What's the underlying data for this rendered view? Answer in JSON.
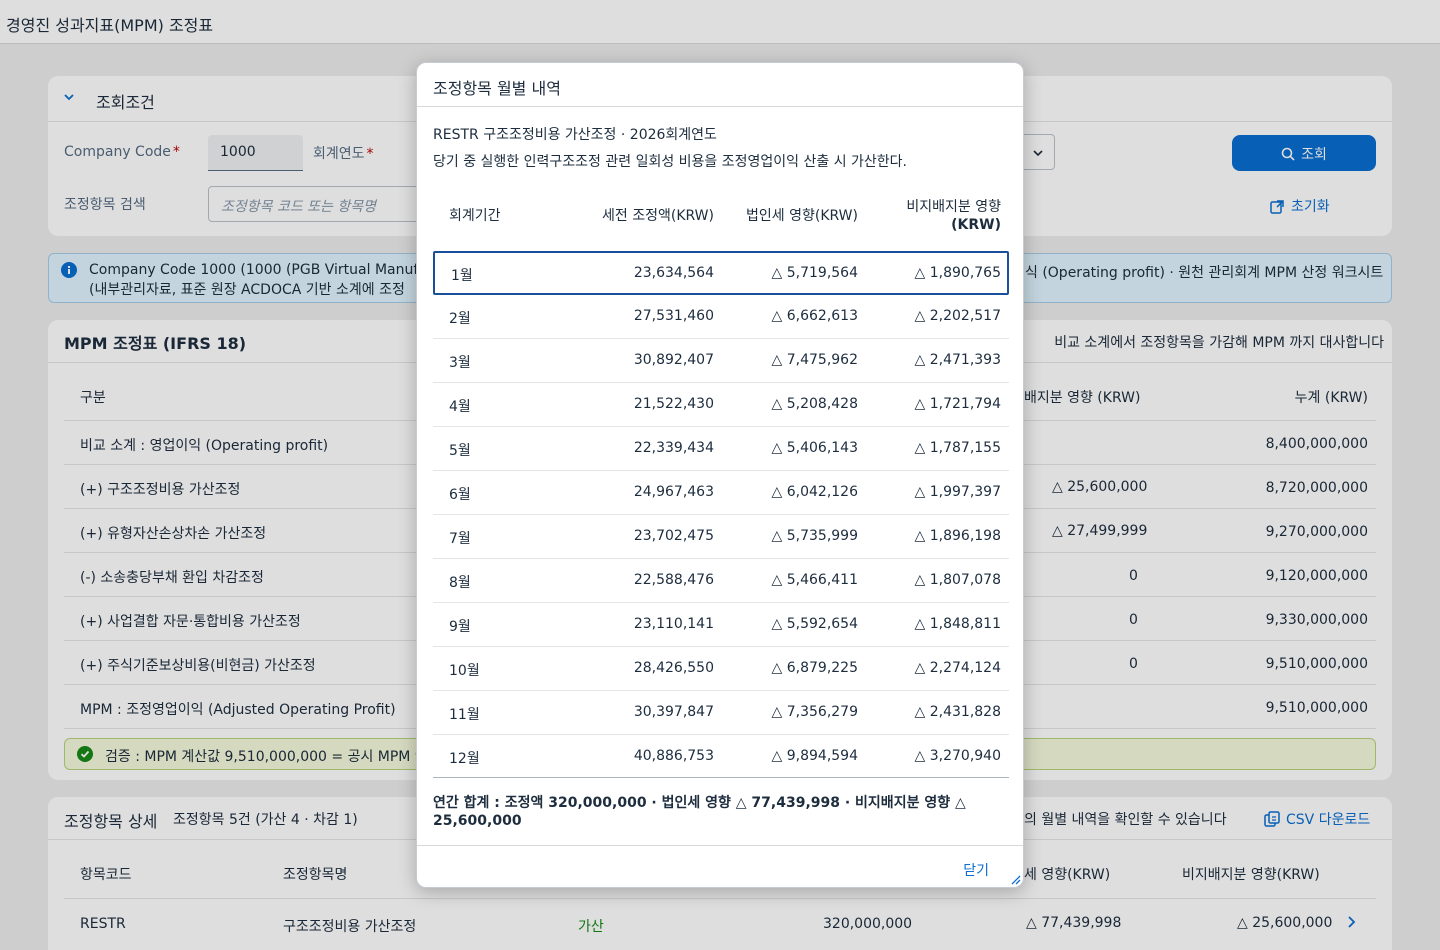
{
  "app": {
    "title": "경영진 성과지표(MPM) 조정표"
  },
  "filter": {
    "header": "조회조건",
    "company_code_label": "Company Code",
    "company_code_value": "1000",
    "fiscal_year_label": "회계연도",
    "required_mark": "*",
    "search_label": "조정항목 검색",
    "search_placeholder": "조정항목 코드 또는 항목명",
    "search_button": "조회",
    "reset_button": "초기화"
  },
  "info": {
    "line1": "Company Code 1000 (1000 (PGB Virtual Manufacturi",
    "line2": "(내부관리자료, 표준 원장 ACDOCA 기반 소계에 조정",
    "line1_tail": "식 (Operating profit) · 원천 관리회계 MPM 산정 워크시트"
  },
  "mpm": {
    "title": "MPM 조정표 (IFRS 18)",
    "hint": "비교 소계에서 조정항목을 가감해 MPM 까지 대사합니다",
    "hint_bold": "MPM",
    "col_category": "구분",
    "col_nci": "배지분 영향 (KRW)",
    "col_cumulative": "누계 (KRW)",
    "rows": [
      {
        "label": "비교 소계 : 영업이익 (Operating profit)",
        "nci": "",
        "cum": "8,400,000,000"
      },
      {
        "label": "(+) 구조조정비용 가산조정",
        "nci": "△ 25,600,000",
        "cum": "8,720,000,000"
      },
      {
        "label": "(+) 유형자산손상차손 가산조정",
        "nci": "△ 27,499,999",
        "cum": "9,270,000,000"
      },
      {
        "label": "(-) 소송충당부채 환입 차감조정",
        "nci": "0",
        "cum": "9,120,000,000"
      },
      {
        "label": "(+) 사업결합 자문·통합비용 가산조정",
        "nci": "0",
        "cum": "9,330,000,000"
      },
      {
        "label": "(+) 주식기준보상비용(비현금) 가산조정",
        "nci": "0",
        "cum": "9,510,000,000"
      },
      {
        "label": "MPM : 조정영업이익 (Adjusted Operating Profit)",
        "nci": "",
        "cum": "9,510,000,000"
      }
    ],
    "verify": "검증 : MPM 계산값 9,510,000,000 = 공시 MPM 9,5"
  },
  "detail": {
    "title": "조정항목 상세",
    "count": "조정항목 5건 (가산 4 · 차감 1)",
    "hint": "의 월별 내역을 확인할 수 있습니다",
    "csv": "CSV 다운로드",
    "col_code": "항목코드",
    "col_name": "조정항목명",
    "col_tax": "세 영향(KRW)",
    "col_nci": "비지배지분 영향(KRW)",
    "row": {
      "code": "RESTR",
      "name": "구조조정비용 가산조정",
      "type": "가산",
      "amount": "320,000,000",
      "tax": "△ 77,439,998",
      "nci": "△ 25,600,000"
    }
  },
  "dialog": {
    "title": "조정항목 월별 내역",
    "subtitle": "RESTR 구조조정비용 가산조정 · 2026회계연도",
    "description": "당기 중 실행한 인력구조조정 관련 일회성 비용을 조정영업이익 산출 시 가산한다.",
    "col_period": "회계기간",
    "col_pretax": "세전 조정액(KRW)",
    "col_tax": "법인세 영향(KRW)",
    "col_nci_1": "비지배지분 영향",
    "col_nci_2": "(KRW)",
    "rows": [
      {
        "period": "1월",
        "pretax": "23,634,564",
        "tax": "△ 5,719,564",
        "nci": "△ 1,890,765"
      },
      {
        "period": "2월",
        "pretax": "27,531,460",
        "tax": "△ 6,662,613",
        "nci": "△ 2,202,517"
      },
      {
        "period": "3월",
        "pretax": "30,892,407",
        "tax": "△ 7,475,962",
        "nci": "△ 2,471,393"
      },
      {
        "period": "4월",
        "pretax": "21,522,430",
        "tax": "△ 5,208,428",
        "nci": "△ 1,721,794"
      },
      {
        "period": "5월",
        "pretax": "22,339,434",
        "tax": "△ 5,406,143",
        "nci": "△ 1,787,155"
      },
      {
        "period": "6월",
        "pretax": "24,967,463",
        "tax": "△ 6,042,126",
        "nci": "△ 1,997,397"
      },
      {
        "period": "7월",
        "pretax": "23,702,475",
        "tax": "△ 5,735,999",
        "nci": "△ 1,896,198"
      },
      {
        "period": "8월",
        "pretax": "22,588,476",
        "tax": "△ 5,466,411",
        "nci": "△ 1,807,078"
      },
      {
        "period": "9월",
        "pretax": "23,110,141",
        "tax": "△ 5,592,654",
        "nci": "△ 1,848,811"
      },
      {
        "period": "10월",
        "pretax": "28,426,550",
        "tax": "△ 6,879,225",
        "nci": "△ 2,274,124"
      },
      {
        "period": "11월",
        "pretax": "30,397,847",
        "tax": "△ 7,356,279",
        "nci": "△ 2,431,828"
      },
      {
        "period": "12월",
        "pretax": "40,886,753",
        "tax": "△ 9,894,594",
        "nci": "△ 3,270,940"
      }
    ],
    "summary": "연간 합계 : 조정액 320,000,000 · 법인세 영향 △ 77,439,998 · 비지배지분 영향 △ 25,600,000",
    "close": "닫기"
  },
  "colors": {
    "accent": "#0a6ed1",
    "selected_border": "#1a4f9c",
    "success": "#188918"
  }
}
